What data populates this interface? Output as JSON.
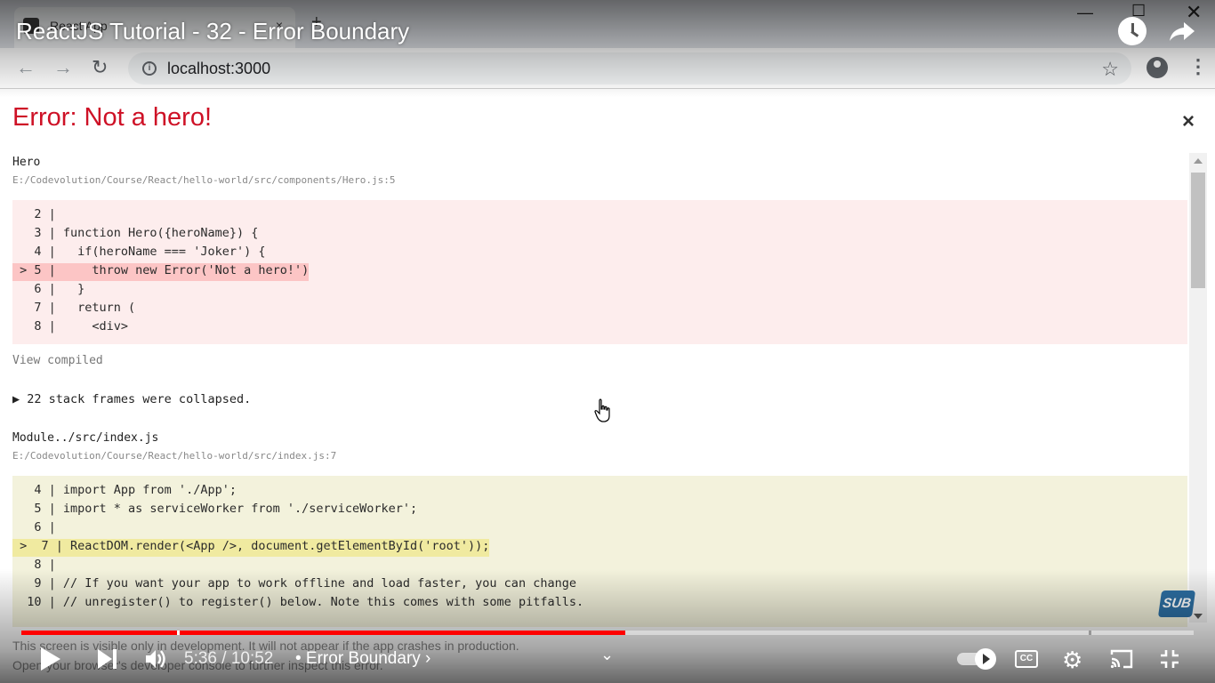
{
  "browser": {
    "tab_title": "React App",
    "tab_close": "×",
    "new_tab": "+",
    "url": "localhost:3000",
    "icons": [
      "back-arrow-icon",
      "forward-arrow-icon",
      "reload-icon",
      "info-icon",
      "star-icon",
      "profile-icon",
      "menu-icon"
    ]
  },
  "video": {
    "title": "ReactJS Tutorial - 32 - Error Boundary",
    "time": "5:36 / 10:52",
    "chapter": "• Error Boundary",
    "progress_fraction": 0.515,
    "accent_color": "#ff0000"
  },
  "error": {
    "title": "Error: Not a hero!",
    "close": "×",
    "title_color": "#ce1126",
    "frame1": {
      "name": "Hero",
      "path": "E:/Codevolution/Course/React/hello-world/src/components/Hero.js:5",
      "lines": [
        {
          "text": "   2 | ",
          "highlight": false
        },
        {
          "text": "   3 | function Hero({heroName}) {",
          "highlight": false
        },
        {
          "text": "   4 |   if(heroName === 'Joker') {",
          "highlight": false
        },
        {
          "text": " > 5 |     throw new Error('Not a hero!')",
          "highlight": true
        },
        {
          "text": "   6 |   }",
          "highlight": false
        },
        {
          "text": "   7 |   return (",
          "highlight": false
        },
        {
          "text": "   8 |     <div>",
          "highlight": false
        }
      ]
    },
    "view_compiled": "View compiled",
    "collapsed": "▶ 22 stack frames were collapsed.",
    "frame2": {
      "name": "Module../src/index.js",
      "path": "E:/Codevolution/Course/React/hello-world/src/index.js:7",
      "lines": [
        {
          "text": "   4 | import App from './App';",
          "highlight": false
        },
        {
          "text": "   5 | import * as serviceWorker from './serviceWorker';",
          "highlight": false
        },
        {
          "text": "   6 | ",
          "highlight": false
        },
        {
          "text": " >  7 | ReactDOM.render(<App />, document.getElementById('root'));",
          "highlight": true
        },
        {
          "text": "   8 | ",
          "highlight": false
        },
        {
          "text": "   9 | // If you want your app to work offline and load faster, you can change",
          "highlight": false
        },
        {
          "text": "  10 | // unregister() to register() below. Note this comes with some pitfalls.",
          "highlight": false
        }
      ]
    },
    "footer_line1": "This screen is visible only in development. It will not appear if the app crashes in production.",
    "footer_line2": "Open your browser's developer console to further inspect this error."
  },
  "overlay": {
    "sub_badge": "SUB"
  }
}
